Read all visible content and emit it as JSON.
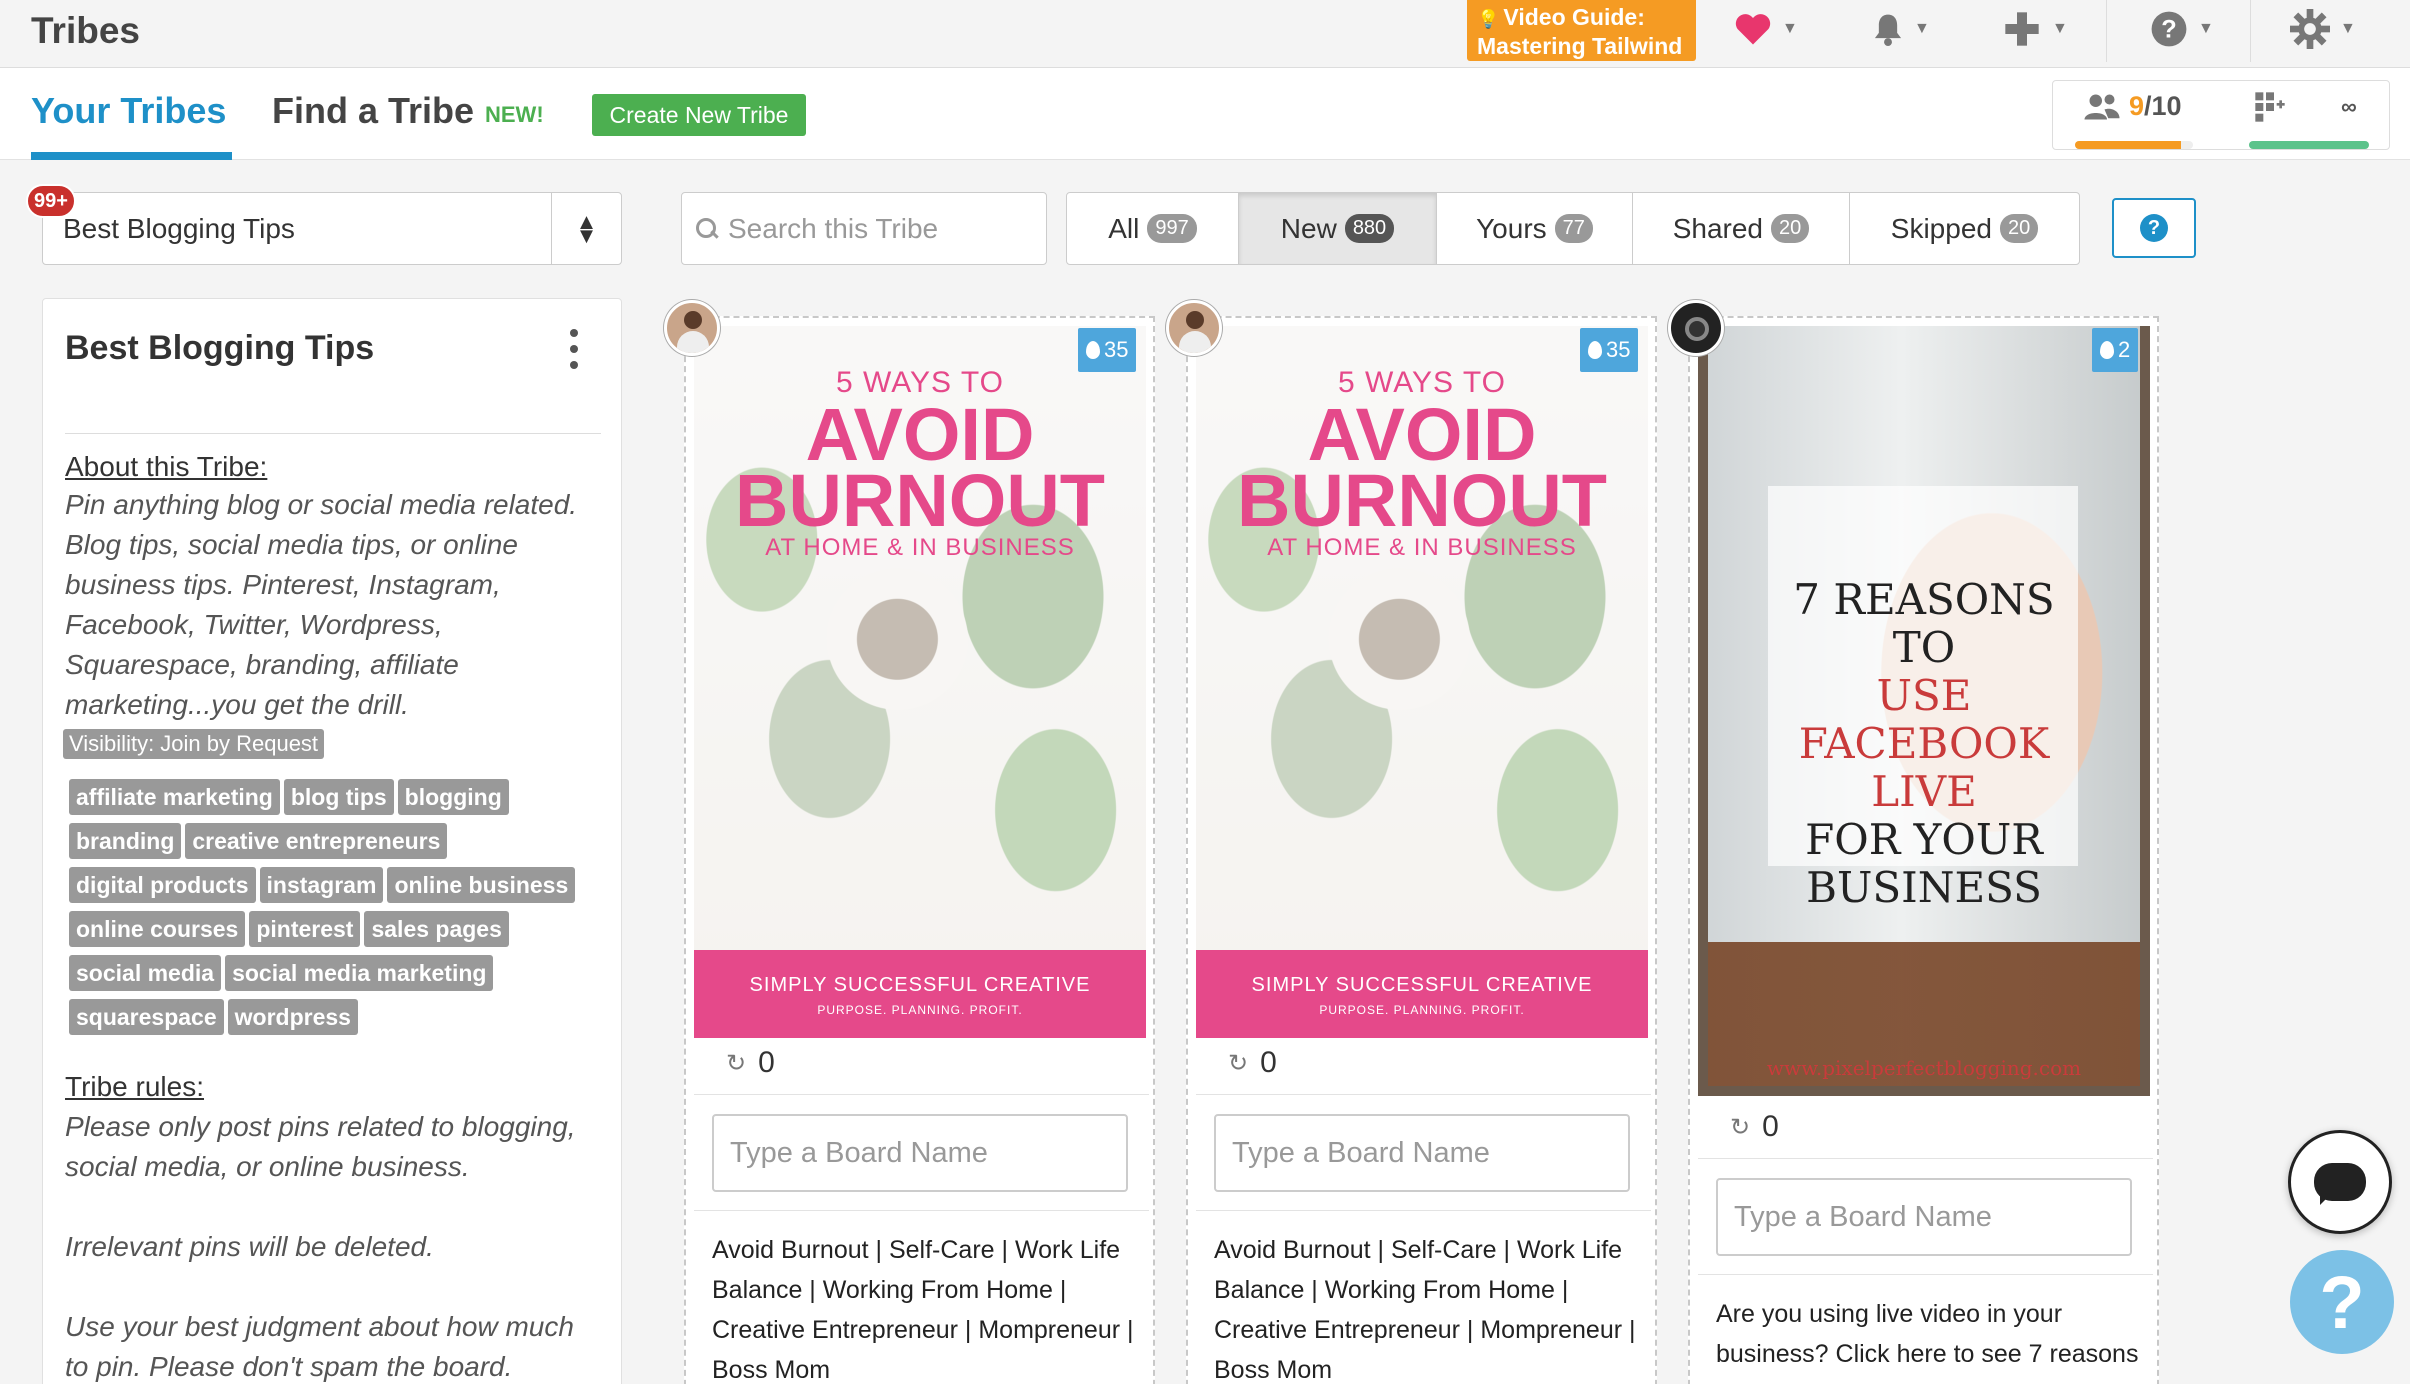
{
  "header": {
    "brand": "Tribes",
    "video_guide": [
      "Video Guide:",
      "Mastering Tailwind"
    ],
    "icons": [
      "heart-icon",
      "bell-icon",
      "plus-icon",
      "question-icon",
      "gear-icon"
    ]
  },
  "tabs": {
    "your_tribes": "Your Tribes",
    "find_tribe": "Find a Tribe",
    "new_badge": "NEW!",
    "create_button": "Create New Tribe"
  },
  "stats": {
    "members_used": "9",
    "members_total": "/10",
    "members_fill": 0.9,
    "boards_value": "∞",
    "boards_fill": 1.0
  },
  "filters": {
    "tribe_selected": "Best Blogging Tips",
    "notification_count": "99+",
    "search_placeholder": "Search this Tribe",
    "buttons": [
      {
        "label": "All",
        "count": "997"
      },
      {
        "label": "New",
        "count": "880"
      },
      {
        "label": "Yours",
        "count": "77"
      },
      {
        "label": "Shared",
        "count": "20"
      },
      {
        "label": "Skipped",
        "count": "20"
      }
    ],
    "help_label": "?"
  },
  "panel": {
    "title": "Best Blogging Tips",
    "about_heading": "About this Tribe:",
    "about_text": "Pin anything blog or social media related. Blog tips, social media tips, or online business tips. Pinterest, Instagram, Facebook, Twitter, Wordpress, Squarespace, branding, affiliate marketing...you get the drill.",
    "visibility": "Visibility: Join by Request",
    "tags": [
      "affiliate marketing",
      "blog tips",
      "blogging",
      "branding",
      "creative entrepreneurs",
      "digital products",
      "instagram",
      "online business",
      "online courses",
      "pinterest",
      "sales pages",
      "social media",
      "social media marketing",
      "squarespace",
      "wordpress"
    ],
    "rules_heading": "Tribe rules:",
    "rules": [
      "Please only post pins related to blogging, social media, or online business.",
      "Irrelevant pins will be deleted.",
      "Use your best judgment about how much to pin. Please don't spam the board."
    ]
  },
  "cards": [
    {
      "heat": "35",
      "pin_small": "5 WAYS TO",
      "pin_big": [
        "AVOID",
        "BURNOUT"
      ],
      "pin_sub": "AT HOME & IN BUSINESS",
      "pin_footer": "SIMPLY SUCCESSFUL CREATIVE",
      "pin_footer_sub": "PURPOSE. PLANNING. PROFIT.",
      "repins": "0",
      "board_placeholder": "Type a Board Name",
      "description": "Avoid Burnout | Self-Care | Work Life Balance | Working From Home | Creative Entrepreneur | Mompreneur | Boss Mom"
    },
    {
      "heat": "35",
      "pin_small": "5 WAYS TO",
      "pin_big": [
        "AVOID",
        "BURNOUT"
      ],
      "pin_sub": "AT HOME & IN BUSINESS",
      "pin_footer": "SIMPLY SUCCESSFUL CREATIVE",
      "pin_footer_sub": "PURPOSE. PLANNING. PROFIT.",
      "repins": "0",
      "board_placeholder": "Type a Board Name",
      "description": "Avoid Burnout | Self-Care | Work Life Balance | Working From Home | Creative Entrepreneur | Mompreneur | Boss Mom"
    },
    {
      "heat": "2",
      "pin_lines": [
        "7 REASONS",
        "TO",
        "USE",
        "FACEBOOK",
        "LIVE",
        "FOR YOUR",
        "BUSINESS"
      ],
      "pin_url": "www.pixelperfectblogging.com",
      "repins": "0",
      "board_placeholder": "Type a Board Name",
      "description": "Are you using live video in your business? Click here to see 7 reasons"
    }
  ]
}
